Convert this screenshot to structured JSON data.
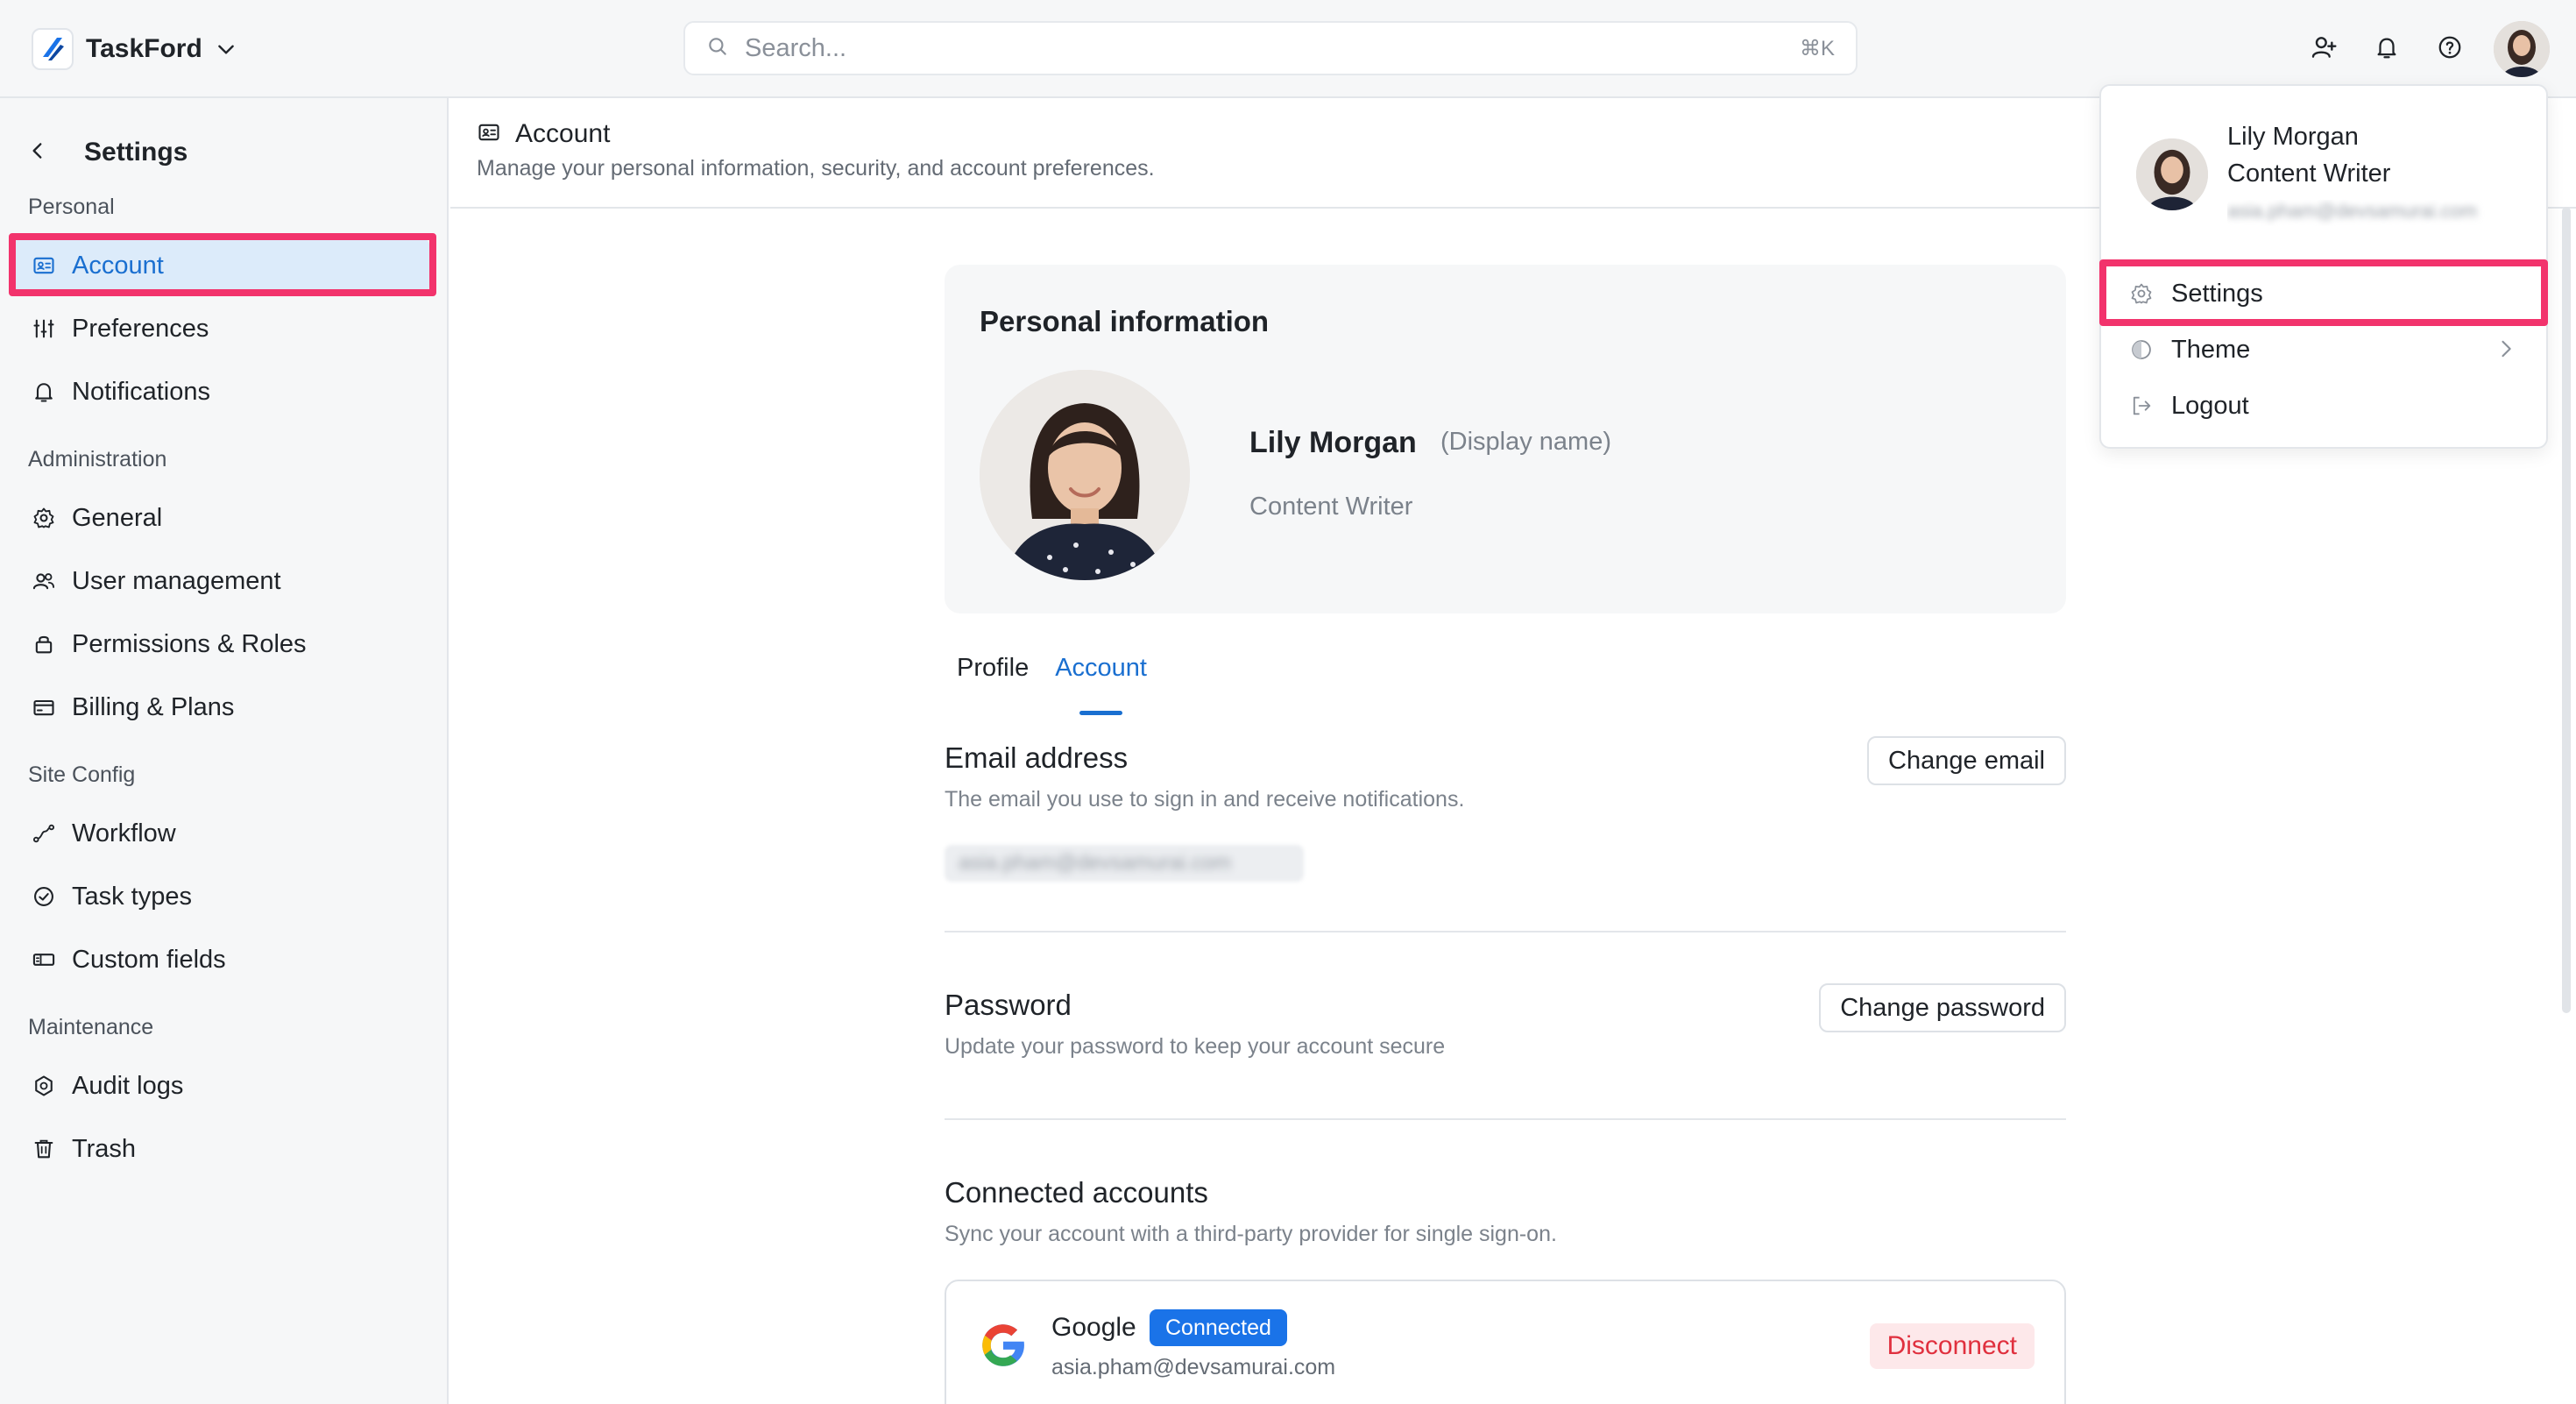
{
  "app": {
    "name": "TaskFord"
  },
  "search": {
    "placeholder": "Search...",
    "shortcut": "⌘K"
  },
  "sidebar": {
    "title": "Settings",
    "sections": {
      "personal": "Personal",
      "administration": "Administration",
      "site_config": "Site Config",
      "maintenance": "Maintenance"
    },
    "items": {
      "account": "Account",
      "preferences": "Preferences",
      "notifications": "Notifications",
      "general": "General",
      "user_management": "User management",
      "permissions": "Permissions & Roles",
      "billing": "Billing & Plans",
      "workflow": "Workflow",
      "task_types": "Task types",
      "custom_fields": "Custom fields",
      "audit_logs": "Audit logs",
      "trash": "Trash"
    },
    "active": "account"
  },
  "page": {
    "title": "Account",
    "subtitle": "Manage your personal information, security, and account preferences."
  },
  "personal_info": {
    "title": "Personal information",
    "name": "Lily Morgan",
    "display_hint": "(Display name)",
    "role": "Content Writer"
  },
  "tabs": {
    "profile": "Profile",
    "account": "Account",
    "active": "account"
  },
  "email_section": {
    "title": "Email address",
    "desc": "The email you use to sign in and receive notifications.",
    "value_blurred": "asia.pham@devsamurai.com",
    "button": "Change email"
  },
  "password_section": {
    "title": "Password",
    "desc": "Update your password to keep your account secure",
    "button": "Change password"
  },
  "connected_section": {
    "title": "Connected accounts",
    "desc": "Sync your account with a third-party provider for single sign-on.",
    "provider": "Google",
    "status": "Connected",
    "email": "asia.pham@devsamurai.com",
    "button": "Disconnect"
  },
  "user_menu": {
    "name": "Lily Morgan",
    "role": "Content Writer",
    "email_blurred": "asia.pham@devsamurai.com",
    "items": {
      "settings": "Settings",
      "theme": "Theme",
      "logout": "Logout"
    }
  },
  "colors": {
    "accent": "#1a6fd0",
    "highlight": "#f2336c",
    "badge": "#1a73e8",
    "danger": "#e0303e",
    "sidebar_bg": "#f6f7f8"
  },
  "icons": {
    "top": [
      "add-user-icon",
      "bell-icon",
      "help-icon"
    ],
    "menu": [
      "gear-icon",
      "theme-icon",
      "logout-icon"
    ]
  }
}
